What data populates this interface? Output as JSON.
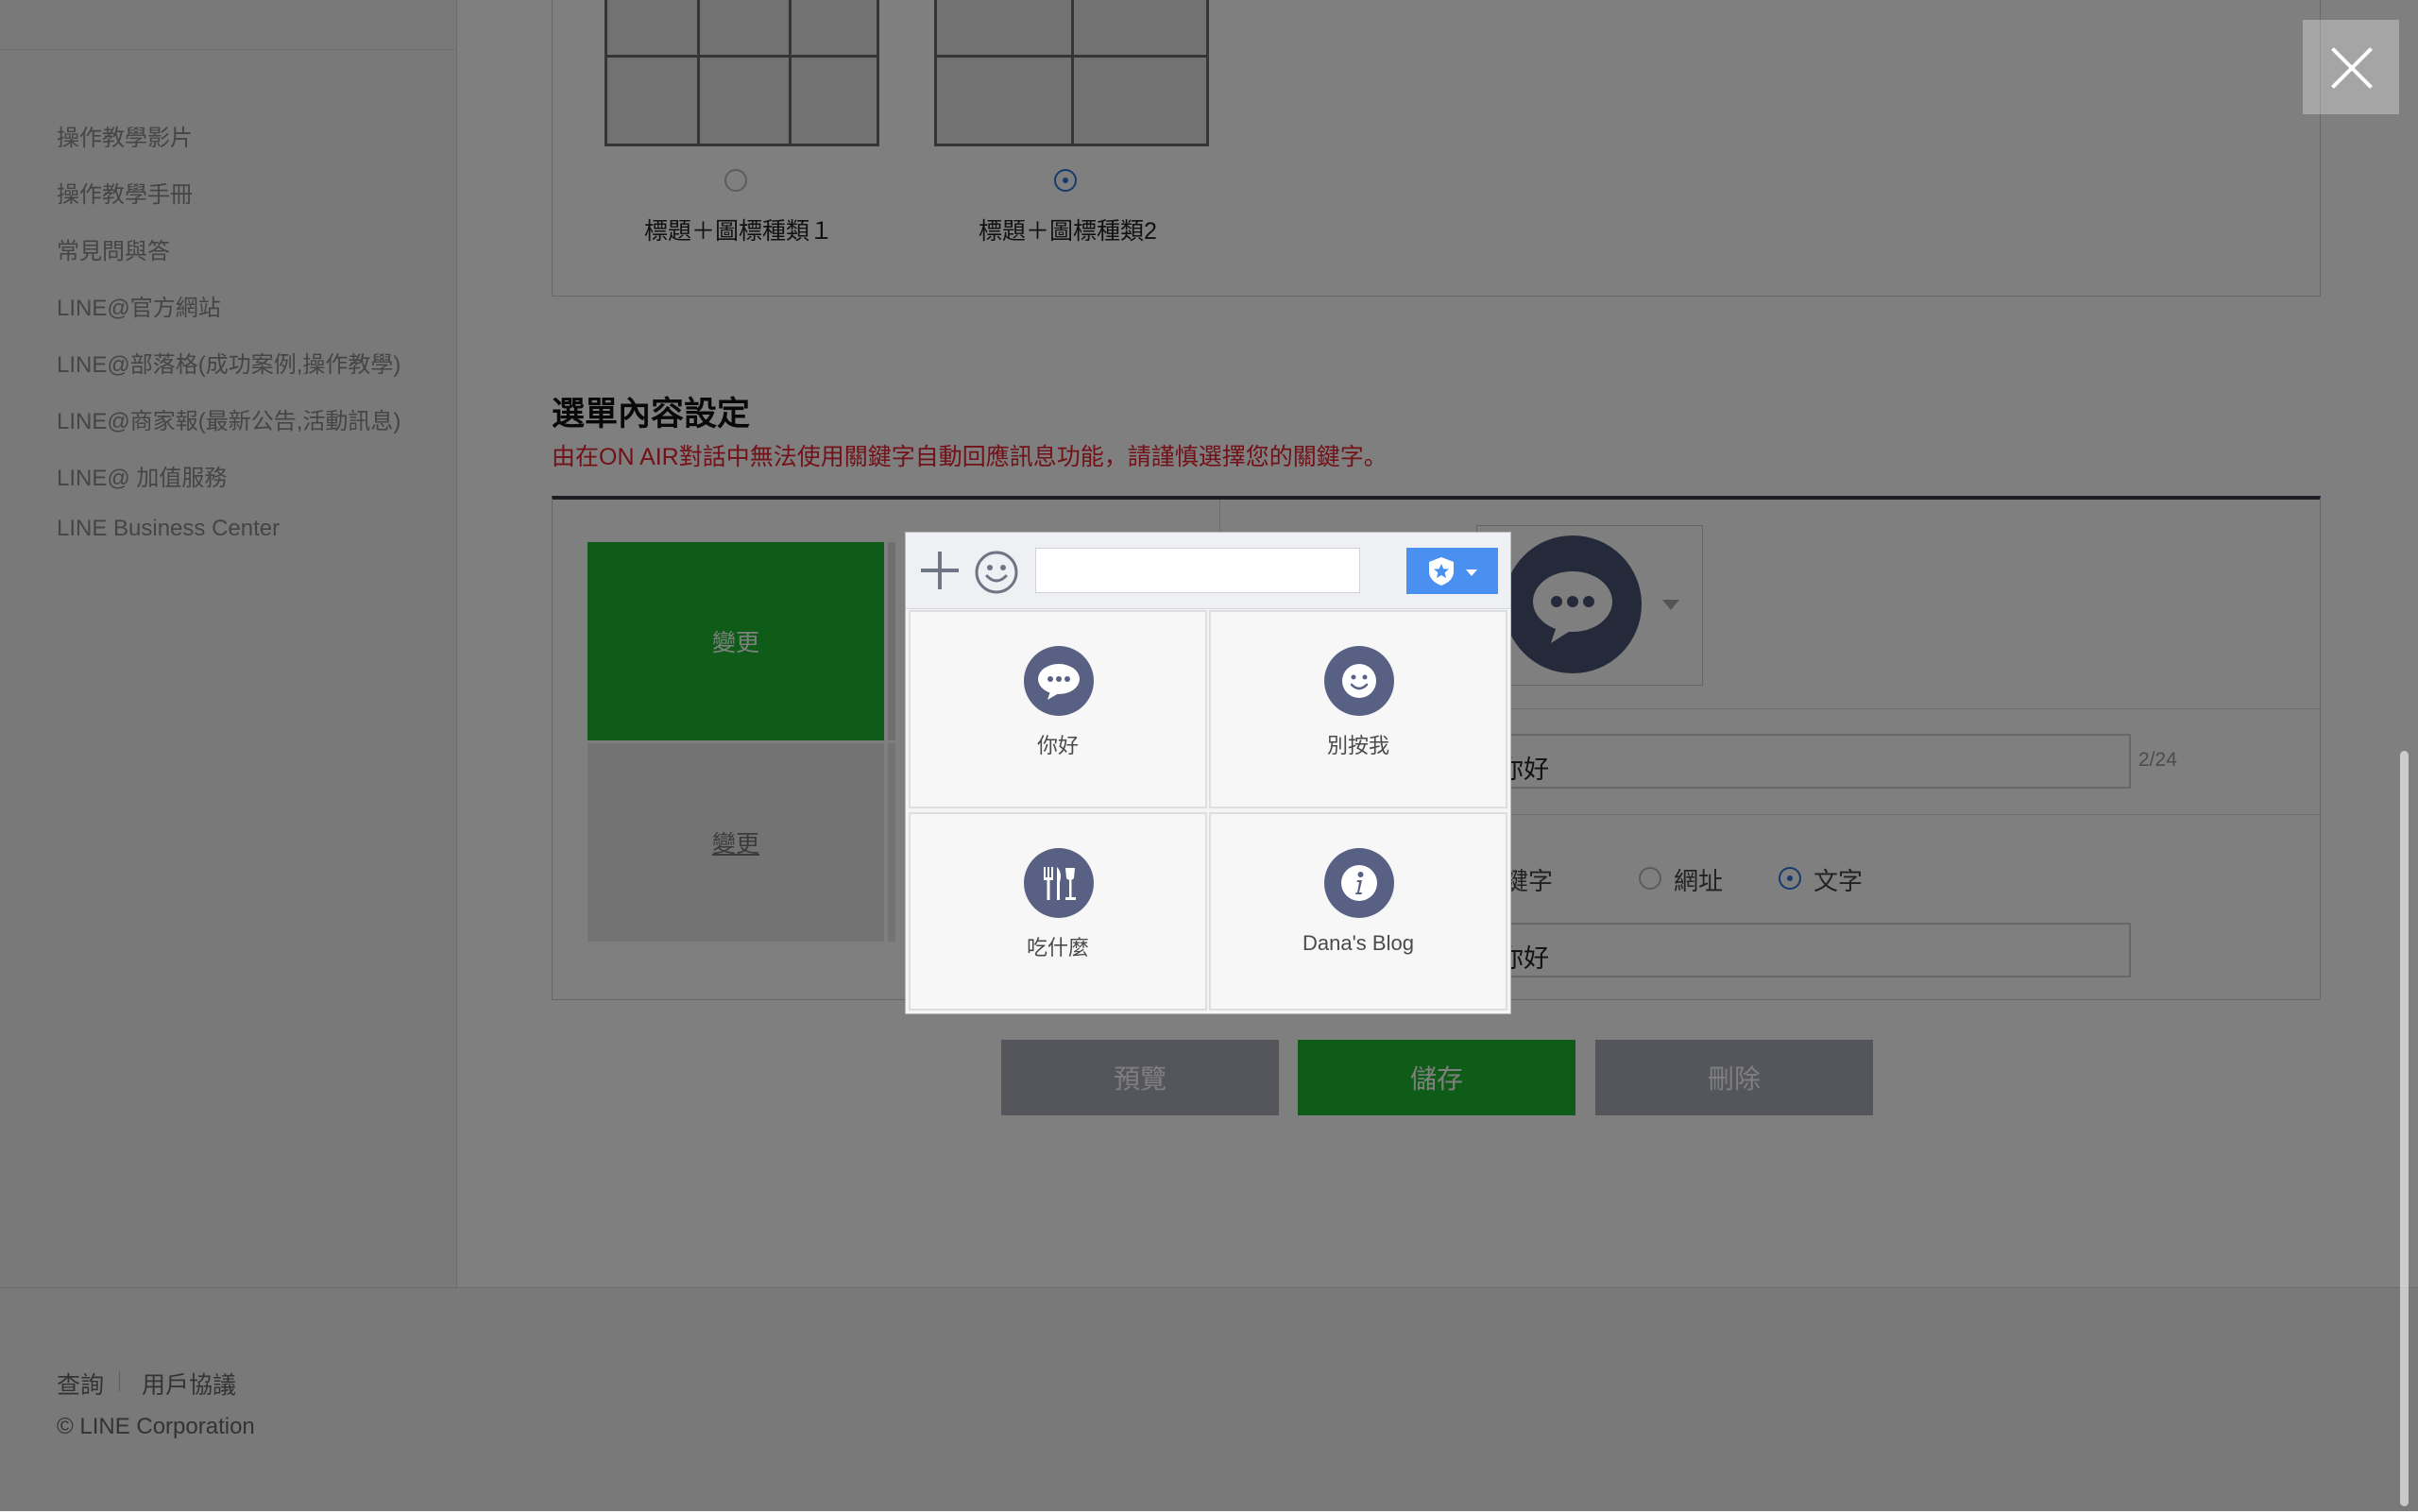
{
  "sidebar": {
    "links": [
      "操作教學影片",
      "操作教學手冊",
      "常見問與答",
      "LINE@官方網站",
      "LINE@部落格(成功案例,操作教學)",
      "LINE@商家報(最新公告,活動訊息)",
      "LINE@ 加值服務",
      "LINE Business Center"
    ]
  },
  "layout_options": {
    "option1": {
      "label": "標題＋圖標種類１",
      "selected": false
    },
    "option2": {
      "label": "標題＋圖標種類2",
      "selected": true
    }
  },
  "menu_settings": {
    "title": "選單內容設定",
    "warning": "由在ON AIR對話中無法使用關鍵字自動回應訊息功能，請謹慎選擇您的關鍵字。",
    "tile_change_label_1": "變更",
    "tile_change_label_2": "變更",
    "label_text_value": "你好",
    "label_char_count": "2/24",
    "action_options": {
      "keyword": "關鍵字",
      "url": "網址",
      "text": "文字",
      "selected": "text"
    },
    "action_text_value": "你好"
  },
  "buttons": {
    "preview": "預覽",
    "save": "儲存",
    "delete": "刪除"
  },
  "footer": {
    "inquiry": "查詢",
    "terms": "用戶協議",
    "copyright": "© LINE Corporation"
  },
  "preview_modal": {
    "message_input": {
      "value": "",
      "placeholder": ""
    },
    "menu_items": [
      {
        "label": "你好",
        "icon": "chat-bubble-icon"
      },
      {
        "label": "別按我",
        "icon": "smiley-icon"
      },
      {
        "label": "吃什麼",
        "icon": "utensils-icon"
      },
      {
        "label": "Dana's Blog",
        "icon": "info-icon"
      }
    ]
  },
  "colors": {
    "line_green": "#1db82f",
    "warning_red": "#e4232e",
    "radio_blue": "#2f73d8",
    "bot_toggle_blue": "#4a90f0",
    "menu_icon_navy": "#586184"
  }
}
